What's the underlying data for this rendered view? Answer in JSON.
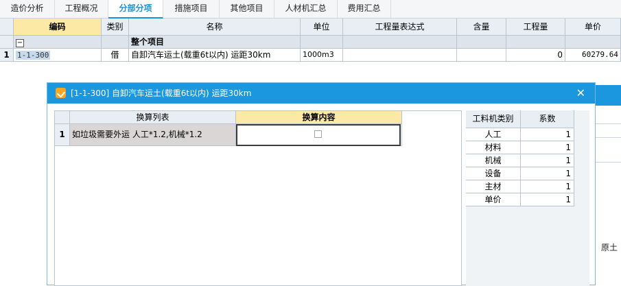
{
  "tabs": [
    "造价分析",
    "工程概况",
    "分部分项",
    "措施项目",
    "其他项目",
    "人材机汇总",
    "费用汇总"
  ],
  "grid": {
    "headers": {
      "code": "编码",
      "type": "类别",
      "name": "名称",
      "unit": "单位",
      "expr": "工程量表达式",
      "content": "含量",
      "qty": "工程量",
      "price": "单价"
    },
    "group_row": {
      "toggle": "−",
      "name": "整个项目"
    },
    "rows": [
      {
        "num": "1",
        "code": "1-1-300",
        "type": "借",
        "name": "自卸汽车运土(载重6t以内) 运距30km",
        "unit": "1000m3",
        "expr": "",
        "content": "",
        "qty": "0",
        "price": "60279.64"
      }
    ]
  },
  "dialog": {
    "title": "[1-1-300] 自卸汽车运土(载重6t以内) 运距30km",
    "close": "✕",
    "conv_table": {
      "headers": {
        "list": "换算列表",
        "content": "换算内容"
      },
      "rows": [
        {
          "num": "1",
          "text": "如垃圾需要外运 人工*1.2,机械*1.2"
        }
      ]
    },
    "factor_table": {
      "headers": {
        "category": "工料机类别",
        "coef": "系数"
      },
      "rows": [
        {
          "name": "人工",
          "value": "1"
        },
        {
          "name": "材料",
          "value": "1"
        },
        {
          "name": "机械",
          "value": "1"
        },
        {
          "name": "设备",
          "value": "1"
        },
        {
          "name": "主材",
          "value": "1"
        },
        {
          "name": "单价",
          "value": "1"
        }
      ]
    }
  },
  "background_text": "、原土"
}
